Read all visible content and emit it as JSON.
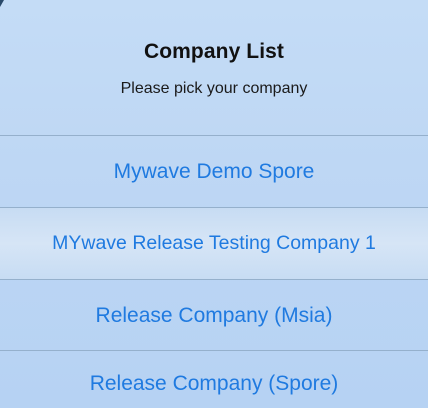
{
  "dialog": {
    "title": "Company List",
    "subtitle": "Please pick your company",
    "options": [
      {
        "label": "Mywave Demo Spore"
      },
      {
        "label": "MYwave Release Testing Company 1"
      },
      {
        "label": "Release Company (Msia)"
      },
      {
        "label": "Release Company (Spore)"
      }
    ]
  },
  "colors": {
    "accent": "#1f7ae0",
    "sheet_background": "#bed7f4",
    "divider": "#95b0cc"
  }
}
